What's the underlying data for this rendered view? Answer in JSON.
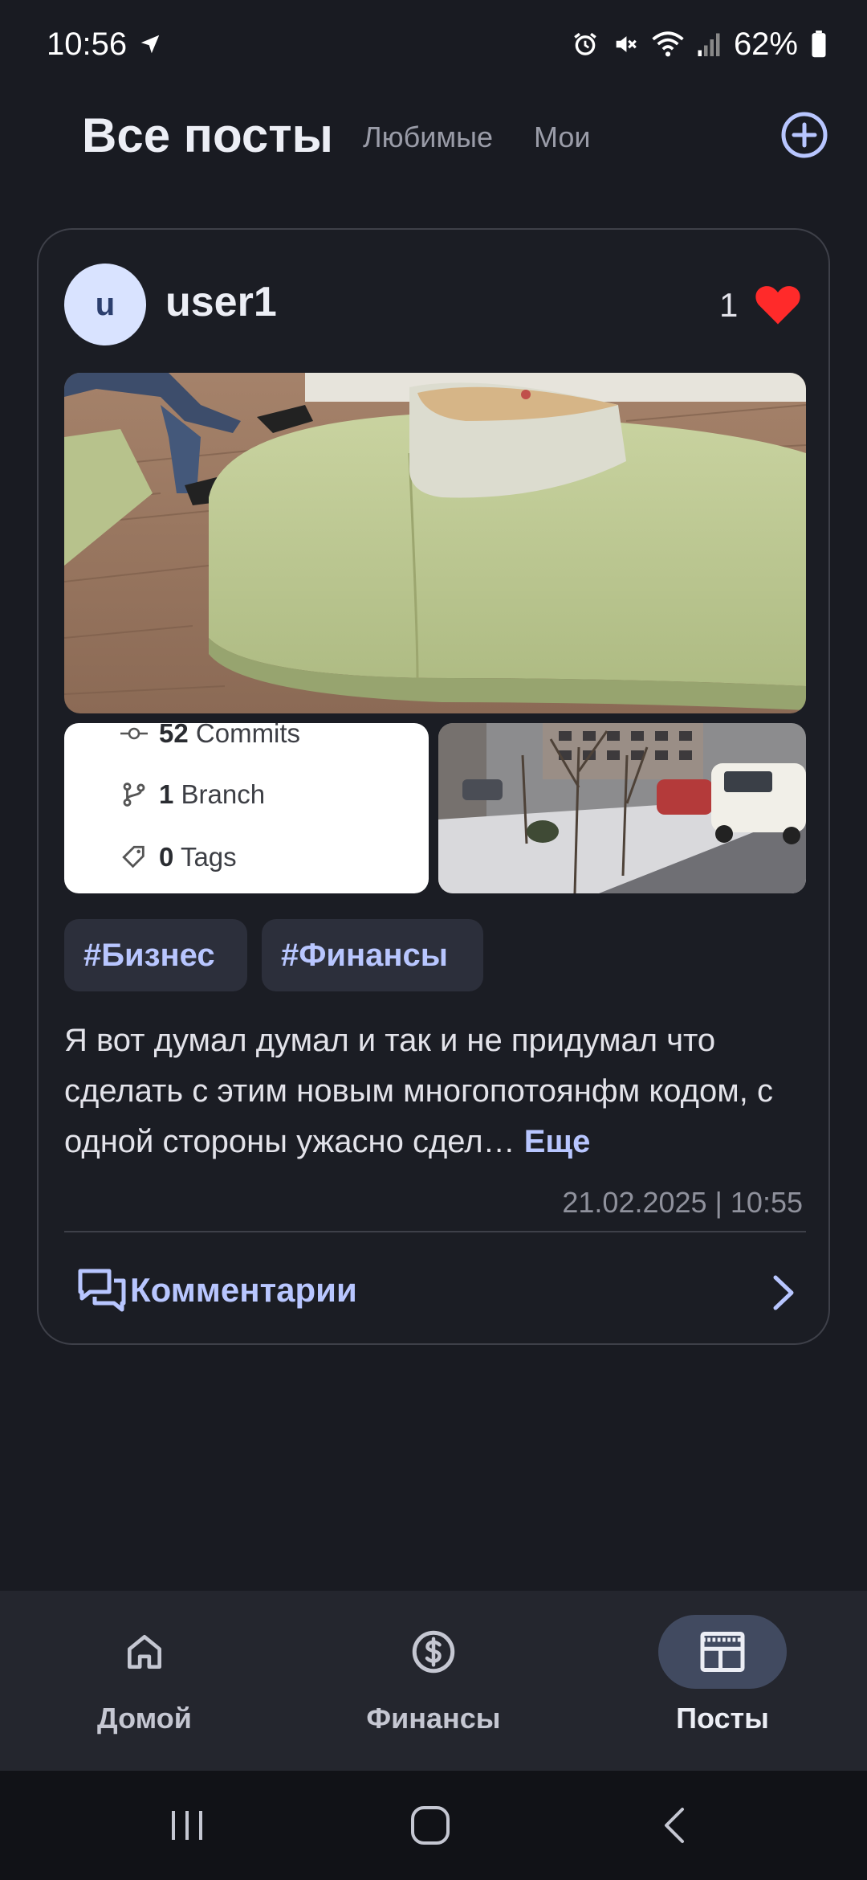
{
  "status_bar": {
    "time": "10:56",
    "battery_percent": "62%",
    "icons": [
      "navigation-arrow-icon",
      "alarm-icon",
      "mute-icon",
      "wifi-icon",
      "signal-icon",
      "battery-icon"
    ]
  },
  "header": {
    "active_tab": "Все посты",
    "tabs": [
      "Любимые",
      "Мои"
    ],
    "add_icon": "plus-circle-icon"
  },
  "post": {
    "avatar_letter": "u",
    "username": "user1",
    "likes": "1",
    "commits_card": {
      "commits_count": "52",
      "commits_label": "Commits",
      "branch_count": "1",
      "branch_label": "Branch",
      "tags_count": "0",
      "tags_label": "Tags"
    },
    "tags": [
      "#Бизнес",
      "#Финансы"
    ],
    "body": "Я вот думал думал и так и не придумал что сделать с этим новым многопотоянфм кодом, с одной стороны ужасно сдел…",
    "more_label": "Еще",
    "date": "21.02.2025 | 10:55",
    "comments_label": "Комментарии"
  },
  "bottom_nav": {
    "items": [
      {
        "label": "Домой",
        "icon": "home-icon"
      },
      {
        "label": "Финансы",
        "icon": "dollar-circle-icon"
      },
      {
        "label": "Посты",
        "icon": "newspaper-icon"
      }
    ],
    "active_index": 2
  },
  "colors": {
    "background": "#191b22",
    "accent": "#b8c6ff",
    "heart": "#ff2a2a",
    "chip": "#2c2f3b",
    "nav_active": "#414a60"
  }
}
